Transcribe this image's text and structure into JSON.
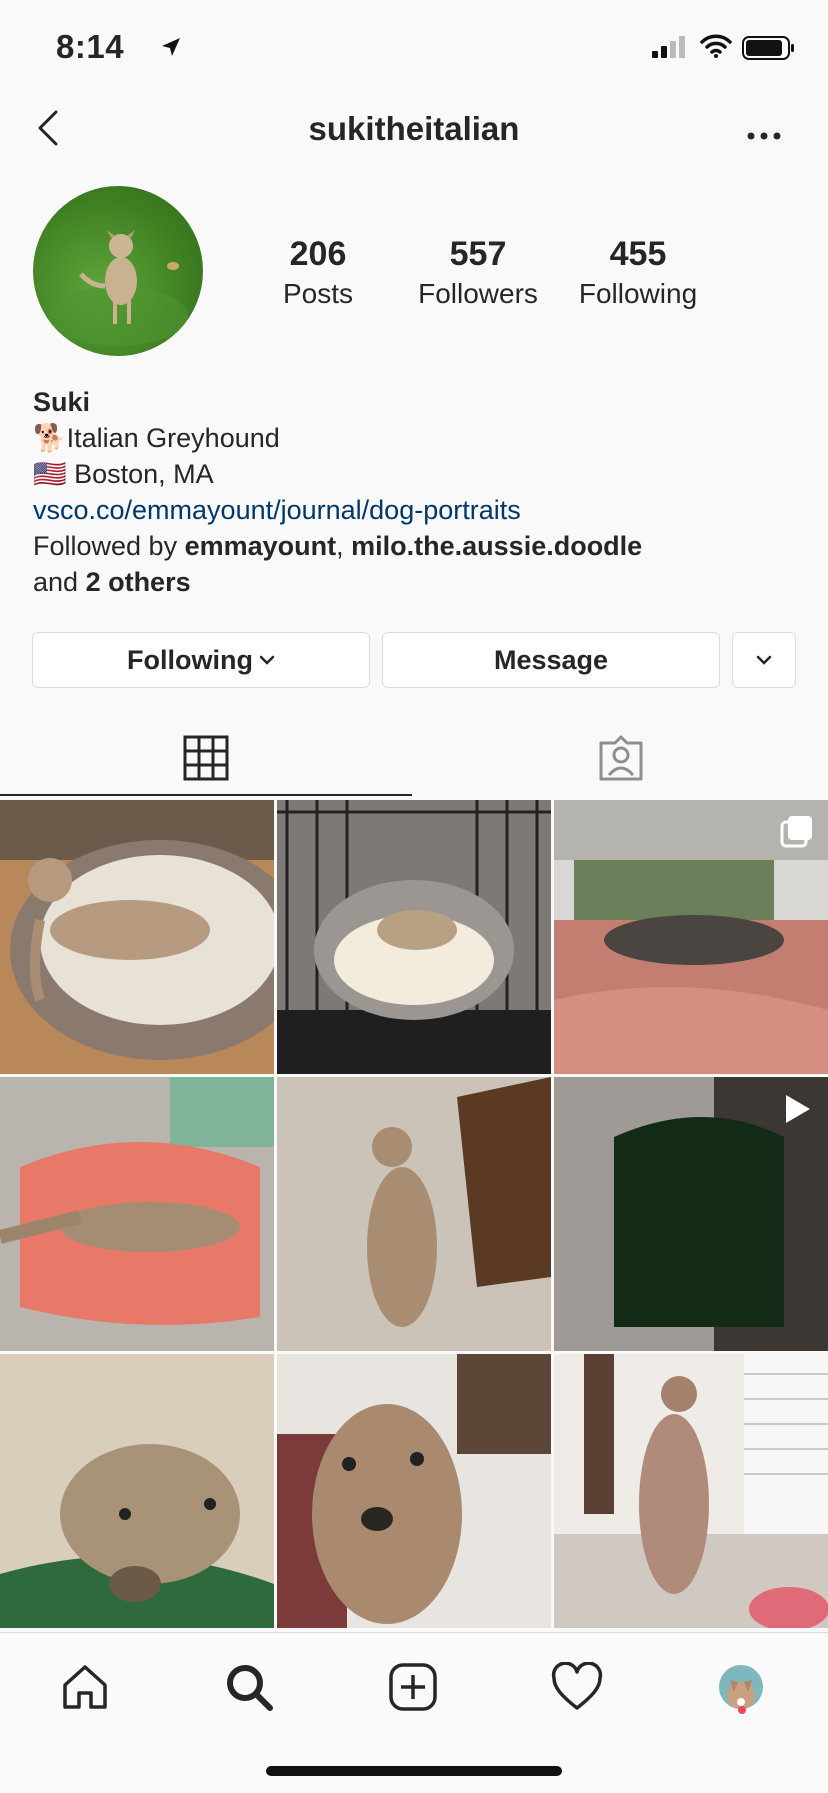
{
  "status_bar": {
    "time": "8:14"
  },
  "header": {
    "username": "sukitheitalian"
  },
  "profile": {
    "stats": [
      {
        "count": "206",
        "label": "Posts"
      },
      {
        "count": "557",
        "label": "Followers"
      },
      {
        "count": "455",
        "label": "Following"
      }
    ],
    "name": "Suki",
    "bio_line1": "🐕Italian Greyhound",
    "bio_line2": "🇺🇸  Boston, MA",
    "link": "vsco.co/emmayount/journal/dog-portraits",
    "followed_by_prefix": "Followed by ",
    "followed_by_user1": "emmayount",
    "followed_by_sep": ", ",
    "followed_by_user2": "milo.the.aussie.doodle",
    "followed_by_and": "and ",
    "followed_by_others": "2 others"
  },
  "actions": {
    "following_label": "Following",
    "message_label": "Message"
  },
  "tabs": [
    "grid-tab",
    "tagged-tab"
  ],
  "grid_posts": [
    {
      "kind": "photo"
    },
    {
      "kind": "photo"
    },
    {
      "kind": "carousel"
    },
    {
      "kind": "photo"
    },
    {
      "kind": "photo"
    },
    {
      "kind": "video"
    },
    {
      "kind": "photo"
    },
    {
      "kind": "photo"
    },
    {
      "kind": "photo"
    }
  ],
  "bottom_nav": [
    "home-icon",
    "search-icon",
    "new-post-icon",
    "activity-heart-icon",
    "profile-avatar"
  ],
  "colors": {
    "link": "#00376b",
    "text": "#262626",
    "border": "#dbdbdb",
    "notification_dot": "#ed4956"
  }
}
